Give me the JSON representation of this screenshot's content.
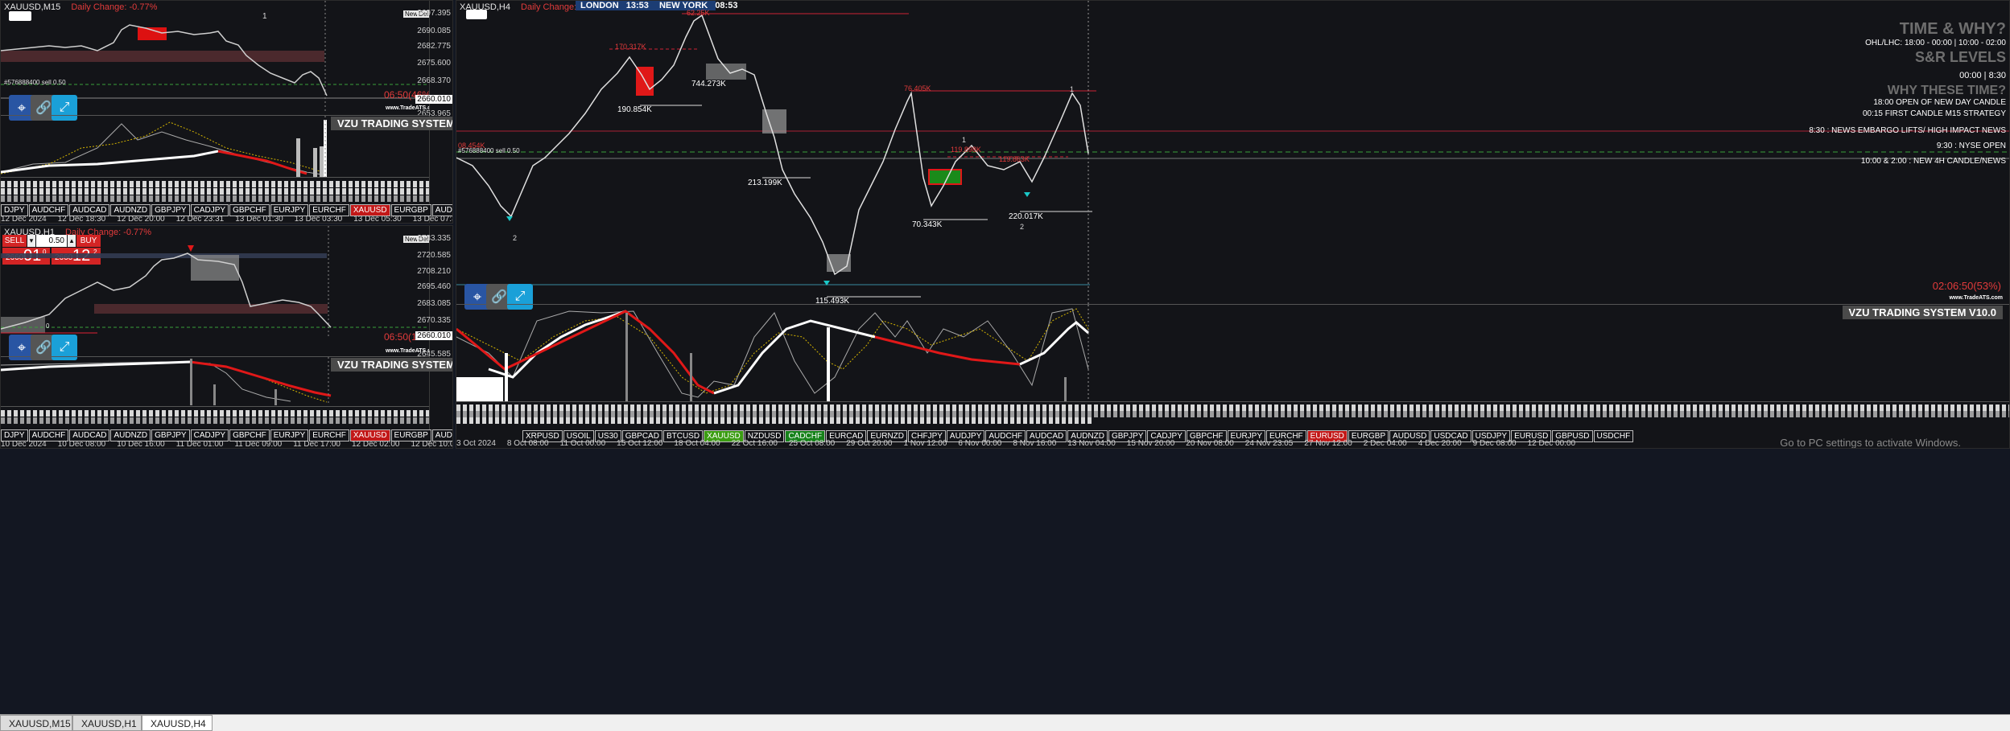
{
  "colors": {
    "bg": "#131418",
    "up": "#ffffff",
    "down": "#8a8a8a",
    "red": "#e23b3b",
    "accent_red": "#c21818",
    "green": "#3b9d12"
  },
  "m15": {
    "title": "XAUUSD,M15",
    "daily_change": "Daily Change: -0.77%",
    "badge_num": "1",
    "order_text": "#576888400 sell 0.50",
    "timer": "06:50(46%)",
    "price_flag": "2660.010",
    "price_ticks": [
      "2697.395",
      "2690.085",
      "2682.775",
      "2675.600",
      "2668.370",
      "2653.965"
    ],
    "brand": "www.TradeATS.com",
    "indicator_title": "VZU TRADING SYSTEM V10.0",
    "ind_ticks": [
      "0",
      "0",
      "0",
      "0",
      "0"
    ],
    "symbols": [
      "DJPY",
      "AUDCHF",
      "AUDCAD",
      "AUDNZD",
      "GBPJPY",
      "CADJPY",
      "GBPCHF",
      "EURJPY",
      "EURCHF",
      "XAUUSD",
      "EURGBP",
      "AUDUSD",
      "USDCAD",
      "USDJPY",
      "EURUSD",
      "GBPUSD",
      "USDCHF"
    ],
    "active_symbol": "XAUUSD",
    "times": [
      "12 Dec 2024",
      "12 Dec 18:30",
      "12 Dec 20:00",
      "12 Dec 23:31",
      "13 Dec 01:30",
      "13 Dec 03:30",
      "13 Dec 05:30",
      "13 Dec 07:30",
      "13 Dec 09:30",
      "13 Dec 11:30",
      "13 Dec 13:30"
    ]
  },
  "h1": {
    "title": "XAUUSD,H1",
    "daily_change": "Daily Change: -0.77%",
    "sell_label": "SELL",
    "buy_label": "BUY",
    "lot": "0.50",
    "sell_price_main": "2660",
    "sell_price_big": "01",
    "sell_price_sup": "0",
    "buy_price_main": "2660",
    "buy_price_big": "12",
    "buy_price_sup": "2",
    "timer": "06:50(11%)",
    "price_flag": "2660.010",
    "order_text": "0",
    "price_ticks": [
      "2733.335",
      "2720.585",
      "2708.210",
      "2695.460",
      "2683.085",
      "2670.335",
      "2645.585"
    ],
    "brand": "www.TradeATS.com",
    "indicator_title": "VZU TRADING SYSTEM V10.0",
    "ind_ticks": [
      "0",
      "0",
      "0",
      "0",
      "0",
      "0"
    ],
    "symbols": [
      "DJPY",
      "AUDCHF",
      "AUDCAD",
      "AUDNZD",
      "GBPJPY",
      "CADJPY",
      "GBPCHF",
      "EURJPY",
      "EURCHF",
      "XAUUSD",
      "EURGBP",
      "AUDUSD",
      "USDCAD",
      "USDJPY",
      "EURUSD",
      "GBPUSD",
      "USDCHF"
    ],
    "active_symbol": "XAUUSD",
    "times": [
      "10 Dec 2024",
      "10 Dec 08:00",
      "10 Dec 16:00",
      "11 Dec 01:00",
      "11 Dec 09:00",
      "11 Dec 17:00",
      "12 Dec 02:00",
      "12 Dec 10:00",
      "12 Dec 18:00",
      "13 Dec 03:00",
      "13 Dec 11:00"
    ]
  },
  "h4": {
    "title": "XAUUSD,H4",
    "daily_change": "Daily Change: -0.77%",
    "london_label": "LONDON",
    "london_time": "13:53",
    "ny_label": "NEW YORK",
    "ny_time": "08:53",
    "order_text": "#576888400 sell 0.50",
    "timer": "02:06:50(53%)",
    "brand": "www.TradeATS.com",
    "indicator_title": "VZU TRADING SYSTEM V10.0",
    "volume_labels": {
      "top": "62.25K",
      "a": "170.317K",
      "b": "190.854K",
      "c": "744.273K",
      "d": "213.199K",
      "e": "115.493K",
      "f": "76.405K",
      "g": "119.898K",
      "h": "119.863K",
      "i": "70.343K",
      "j": "220.017K",
      "k": "08.454K"
    },
    "swing_labels": [
      "1",
      "2",
      "1",
      "2"
    ],
    "info": {
      "heading1": "TIME & WHY?",
      "ohl": "OHL/LHC: 18:00 - 00:00 | 10:00 - 02:00",
      "heading2": "S&R LEVELS",
      "sr": "00:00 | 8:30",
      "heading3": "WHY THESE TIME?",
      "line1": "18:00 OPEN OF NEW DAY CANDLE",
      "line2": "00:15 FIRST CANDLE M15 STRATEGY",
      "line3": "8:30 : NEWS EMBARGO LIFTS/ HIGH IMPACT NEWS",
      "line4": "9:30 : NYSE OPEN",
      "line5": "10:00 & 2:00 : NEW 4H CANDLE/NEWS"
    },
    "symbols": [
      "XRPUSD",
      "USOIL",
      "US30",
      "GBPCAD",
      "BTCUSD",
      "XAUUSD",
      "NZDUSD",
      "CADCHF",
      "EURCAD",
      "EURNZD",
      "CHFJPY",
      "AUDJPY",
      "AUDCHF",
      "AUDCAD",
      "AUDNZD",
      "GBPJPY",
      "CADJPY",
      "GBPCHF",
      "EURJPY",
      "EURCHF",
      "EURUSD",
      "EURGBP",
      "AUDUSD",
      "USDCAD",
      "USDJPY",
      "EURUSD",
      "GBPUSD",
      "USDCHF"
    ],
    "times": [
      "3 Oct 2024",
      "8 Oct 08:00",
      "11 Oct 00:00",
      "15 Oct 12:00",
      "18 Oct 04:00",
      "22 Oct 16:00",
      "25 Oct 08:00",
      "29 Oct 20:00",
      "1 Nov 12:00",
      "6 Nov 00:00",
      "8 Nov 16:00",
      "13 Nov 04:00",
      "15 Nov 20:00",
      "20 Nov 08:00",
      "24 Nov 23:05",
      "27 Nov 12:00",
      "2 Dec 04:00",
      "4 Dec 20:00",
      "9 Dec 08:00",
      "12 Dec 00:00"
    ],
    "watermark": "Go to PC settings to activate Windows."
  },
  "tabs": [
    "XAUUSD,M15",
    "XAUUSD,H1",
    "XAUUSD,H4"
  ],
  "active_tab": "XAUUSD,H4",
  "small_buttons": [
    "New",
    "Del"
  ]
}
